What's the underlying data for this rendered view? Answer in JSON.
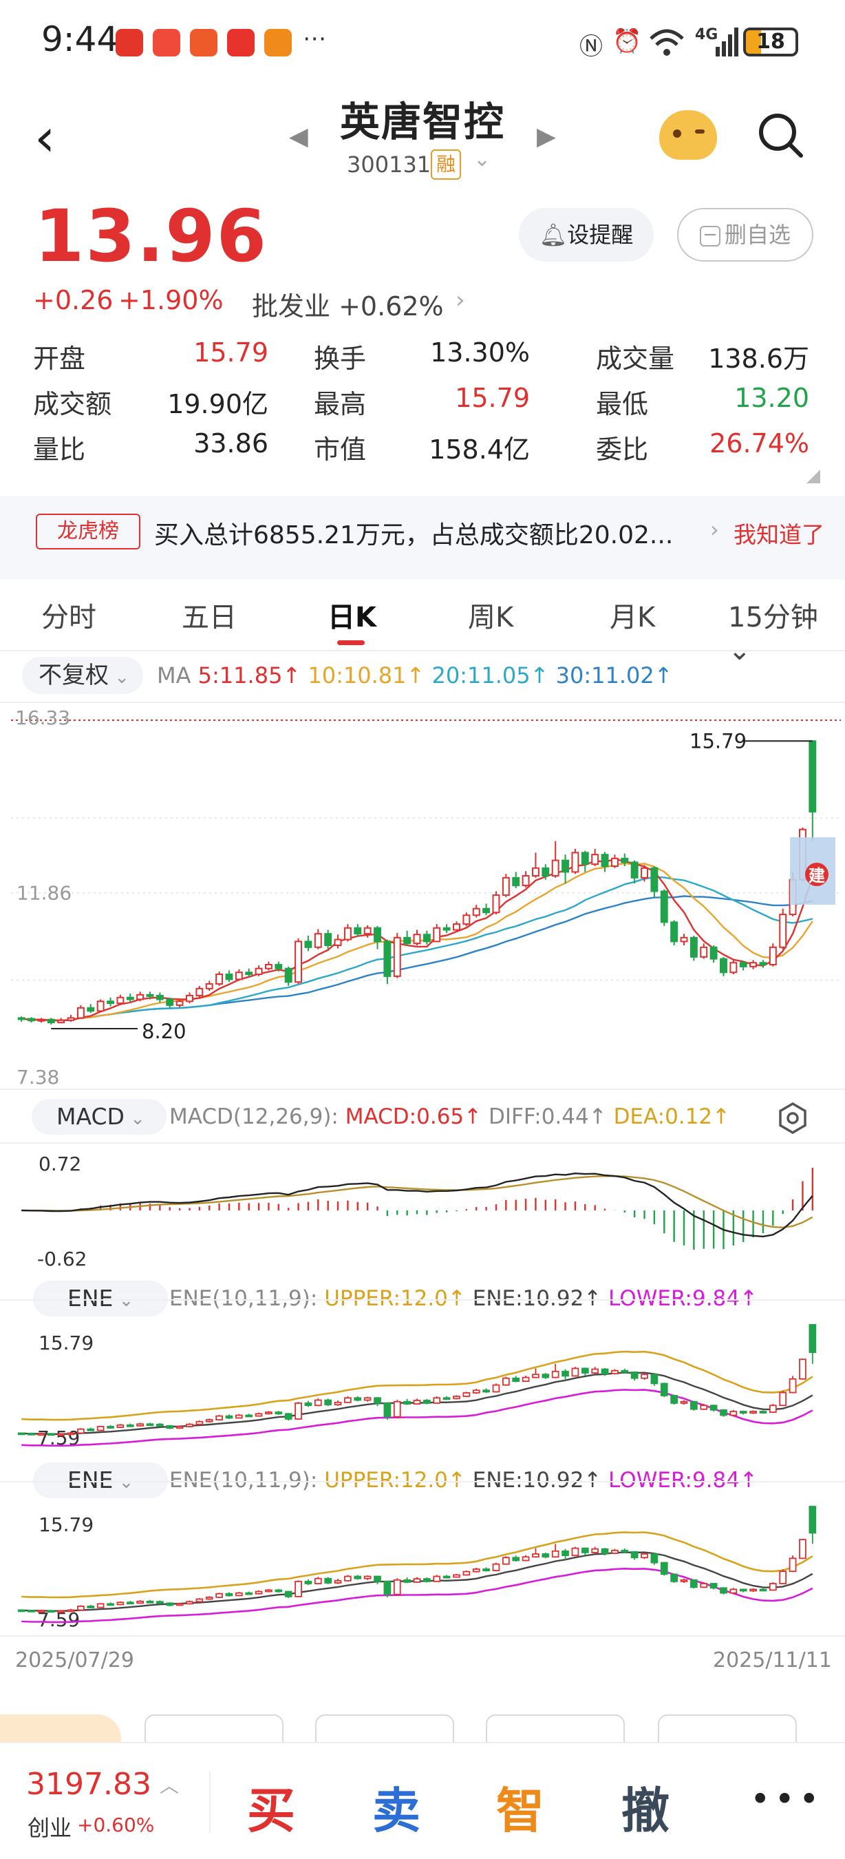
{
  "status_bar": {
    "time": "9:44",
    "network": "4G",
    "battery": "18"
  },
  "header": {
    "title": "英唐智控",
    "code": "300131",
    "badge": "融"
  },
  "quote": {
    "price": "13.96",
    "change": "+0.26",
    "change_pct": "+1.90%",
    "industry": "批发业 +0.62%",
    "alert_label": "设提醒",
    "delete_label": "删自选",
    "stats": [
      {
        "label": "开盘",
        "value": "15.79",
        "color": "red"
      },
      {
        "label": "换手",
        "value": "13.30%",
        "color": "plain"
      },
      {
        "label": "成交量",
        "value": "138.6万",
        "color": "plain"
      },
      {
        "label": "成交额",
        "value": "19.90亿",
        "color": "plain"
      },
      {
        "label": "最高",
        "value": "15.79",
        "color": "red"
      },
      {
        "label": "最低",
        "value": "13.20",
        "color": "green"
      },
      {
        "label": "量比",
        "value": "33.86",
        "color": "plain"
      },
      {
        "label": "市值",
        "value": "158.4亿",
        "color": "plain"
      },
      {
        "label": "委比",
        "value": "26.74%",
        "color": "red"
      }
    ]
  },
  "dragon_tiger": {
    "tag": "龙虎榜",
    "text": "买入总计6855.21万元，占总成交额比20.02...",
    "ack": "我知道了"
  },
  "tabs": [
    "分时",
    "五日",
    "日K",
    "周K",
    "月K",
    "15分钟"
  ],
  "active_tab": "日K",
  "ma_bar": {
    "adjust": "不复权",
    "ma_prefix": "MA",
    "ma5": "5:11.85↑",
    "ma10": "10:10.81↑",
    "ma20": "20:11.05↑",
    "ma30": "30:11.02↑"
  },
  "macd_bar": {
    "name": "MACD",
    "params": "MACD(12,26,9):",
    "macd": "MACD:0.65↑",
    "diff": "DIFF:0.44↑",
    "dea": "DEA:0.12↑"
  },
  "ene_bar": {
    "name": "ENE",
    "params": "ENE(10,11,9):",
    "upper": "UPPER:12.0↑",
    "ene": "ENE:10.92↑",
    "lower": "LOWER:9.84↑"
  },
  "chart_labels": {
    "k_high_axis": "16.33",
    "k_mid_axis": "11.86",
    "k_low_axis": "7.38",
    "k_max_mark": "15.79",
    "k_min_mark": "8.20",
    "build_badge": "建",
    "macd_top": "0.72",
    "macd_bottom": "-0.62",
    "ene_top": "15.79",
    "ene_bottom": "7.59",
    "date_start": "2025/07/29",
    "date_end": "2025/11/11"
  },
  "colors": {
    "up": "#e0302f",
    "down": "#20a34a",
    "ma5": "#e0302f",
    "ma10": "#e8a52c",
    "ma20": "#2ea8c9",
    "ma30": "#2d82c8",
    "upper": "#d9a21b",
    "lower": "#d81bd9"
  },
  "candles": [
    [
      8.62,
      8.6,
      8.66,
      8.52
    ],
    [
      8.6,
      8.55,
      8.64,
      8.5
    ],
    [
      8.55,
      8.58,
      8.62,
      8.5
    ],
    [
      8.58,
      8.5,
      8.62,
      8.45
    ],
    [
      8.5,
      8.56,
      8.62,
      8.48
    ],
    [
      8.56,
      8.62,
      8.7,
      8.52
    ],
    [
      8.62,
      8.88,
      8.95,
      8.6
    ],
    [
      8.88,
      8.8,
      8.98,
      8.75
    ],
    [
      8.8,
      9.05,
      9.1,
      8.78
    ],
    [
      9.05,
      9.0,
      9.15,
      8.92
    ],
    [
      9.0,
      9.15,
      9.22,
      8.95
    ],
    [
      9.15,
      9.1,
      9.25,
      9.02
    ],
    [
      9.1,
      9.22,
      9.3,
      9.05
    ],
    [
      9.22,
      9.2,
      9.3,
      9.1
    ],
    [
      9.2,
      9.1,
      9.28,
      9.02
    ],
    [
      9.1,
      8.95,
      9.15,
      8.88
    ],
    [
      8.95,
      9.05,
      9.12,
      8.9
    ],
    [
      9.05,
      9.2,
      9.28,
      9.0
    ],
    [
      9.2,
      9.38,
      9.45,
      9.15
    ],
    [
      9.38,
      9.5,
      9.58,
      9.32
    ],
    [
      9.5,
      9.75,
      9.82,
      9.45
    ],
    [
      9.75,
      9.62,
      9.85,
      9.55
    ],
    [
      9.62,
      9.8,
      9.88,
      9.58
    ],
    [
      9.8,
      9.75,
      9.9,
      9.68
    ],
    [
      9.75,
      9.9,
      9.98,
      9.7
    ],
    [
      9.9,
      10.0,
      10.08,
      9.85
    ],
    [
      10.0,
      9.9,
      10.08,
      9.82
    ],
    [
      9.9,
      9.55,
      9.95,
      9.45
    ],
    [
      9.55,
      10.6,
      10.68,
      9.5
    ],
    [
      10.6,
      10.45,
      10.75,
      10.35
    ],
    [
      10.45,
      10.8,
      10.92,
      10.4
    ],
    [
      10.8,
      10.5,
      10.9,
      10.4
    ],
    [
      10.5,
      10.65,
      10.78,
      10.42
    ],
    [
      10.65,
      10.95,
      11.05,
      10.6
    ],
    [
      10.95,
      10.8,
      11.05,
      10.72
    ],
    [
      10.8,
      10.95,
      11.02,
      10.7
    ],
    [
      10.95,
      10.6,
      11.0,
      10.4
    ],
    [
      10.6,
      9.7,
      10.65,
      9.5
    ],
    [
      9.7,
      10.7,
      10.82,
      9.65
    ],
    [
      10.7,
      10.55,
      10.88,
      10.48
    ],
    [
      10.55,
      10.78,
      10.9,
      10.5
    ],
    [
      10.78,
      10.6,
      10.88,
      10.52
    ],
    [
      10.6,
      10.95,
      11.05,
      10.58
    ],
    [
      10.95,
      10.9,
      11.05,
      10.82
    ],
    [
      10.9,
      11.05,
      11.12,
      10.85
    ],
    [
      11.05,
      11.28,
      11.35,
      11.0
    ],
    [
      11.28,
      11.45,
      11.55,
      11.22
    ],
    [
      11.45,
      11.35,
      11.58,
      11.28
    ],
    [
      11.35,
      11.8,
      11.9,
      11.3
    ],
    [
      11.8,
      12.25,
      12.35,
      11.75
    ],
    [
      12.25,
      12.05,
      12.4,
      11.98
    ],
    [
      12.05,
      12.3,
      12.42,
      12.0
    ],
    [
      12.3,
      12.5,
      12.9,
      12.25
    ],
    [
      12.5,
      12.3,
      12.6,
      12.2
    ],
    [
      12.3,
      12.7,
      13.2,
      12.25
    ],
    [
      12.7,
      12.4,
      12.85,
      12.1
    ],
    [
      12.4,
      12.9,
      13.0,
      12.35
    ],
    [
      12.9,
      12.6,
      12.95,
      12.4
    ],
    [
      12.6,
      12.85,
      13.0,
      12.55
    ],
    [
      12.85,
      12.55,
      12.92,
      12.4
    ],
    [
      12.55,
      12.75,
      12.85,
      12.5
    ],
    [
      12.75,
      12.65,
      12.88,
      12.55
    ],
    [
      12.65,
      12.25,
      12.7,
      12.1
    ],
    [
      12.25,
      12.5,
      12.58,
      12.15
    ],
    [
      12.5,
      11.9,
      12.55,
      11.75
    ],
    [
      11.9,
      11.1,
      11.95,
      11.0
    ],
    [
      11.1,
      10.6,
      11.15,
      10.5
    ],
    [
      10.6,
      10.7,
      10.8,
      10.5
    ],
    [
      10.7,
      10.2,
      10.75,
      10.1
    ],
    [
      10.2,
      10.45,
      10.55,
      10.15
    ],
    [
      10.45,
      10.15,
      10.5,
      10.05
    ],
    [
      10.15,
      9.8,
      10.2,
      9.7
    ],
    [
      9.8,
      10.05,
      10.15,
      9.75
    ],
    [
      10.05,
      9.95,
      10.1,
      9.85
    ],
    [
      9.95,
      10.05,
      10.12,
      9.88
    ],
    [
      10.05,
      10.0,
      10.12,
      9.92
    ],
    [
      10.0,
      10.45,
      10.55,
      9.95
    ],
    [
      10.45,
      11.3,
      11.45,
      10.4
    ],
    [
      11.3,
      12.2,
      12.4,
      11.25
    ],
    [
      12.2,
      13.5,
      13.55,
      12.15
    ],
    [
      15.79,
      13.96,
      15.79,
      13.2
    ]
  ]
}
